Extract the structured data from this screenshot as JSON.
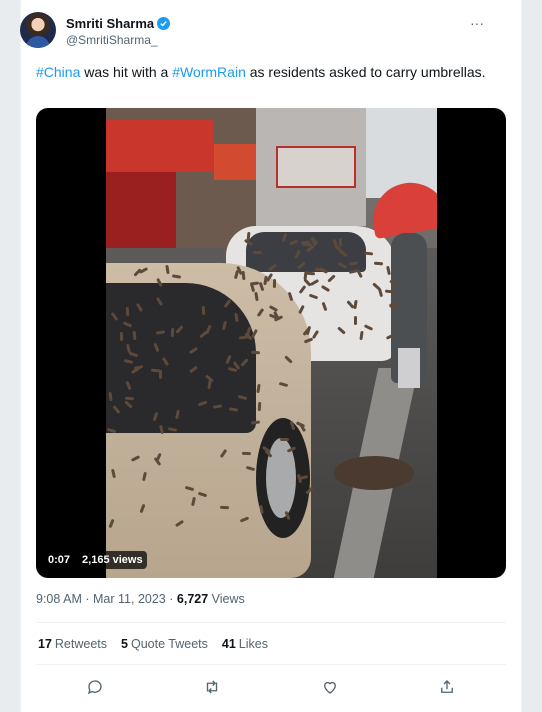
{
  "author": {
    "display_name": "Smriti Sharma",
    "handle": "@SmritiSharma_",
    "verified_icon": "verified-badge-icon"
  },
  "more_icon_glyph": "···",
  "tweet": {
    "hashtag1": "#China",
    "text_mid": " was hit with a ",
    "hashtag2": "#WormRain",
    "text_end": " as residents asked to carry umbrellas."
  },
  "video": {
    "time": "0:07",
    "views": "2,165 views"
  },
  "meta": {
    "time": "9:08 AM",
    "sep": "·",
    "date": "Mar 11, 2023",
    "sep2": "·",
    "views_count": "6,727",
    "views_label": "Views"
  },
  "stats": {
    "retweets_count": "17",
    "retweets_label": "Retweets",
    "quotes_count": "5",
    "quotes_label": "Quote Tweets",
    "likes_count": "41",
    "likes_label": "Likes"
  },
  "actions": [
    "reply-icon",
    "retweet-icon",
    "like-icon",
    "share-icon"
  ],
  "colors": {
    "accent": "#1d9bf0",
    "text_primary": "#0f1419",
    "text_secondary": "#536471"
  }
}
